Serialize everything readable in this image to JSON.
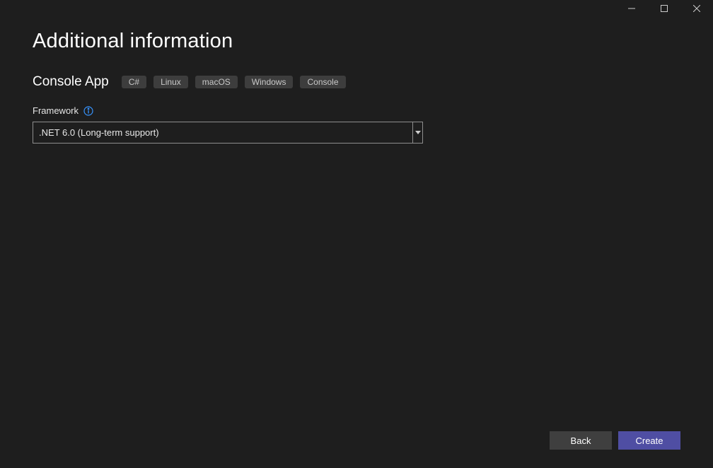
{
  "titlebar": {
    "icons": {
      "minimize": "minimize-icon",
      "maximize": "maximize-icon",
      "close": "close-icon"
    }
  },
  "page": {
    "title": "Additional information"
  },
  "template": {
    "name": "Console App",
    "tags": [
      "C#",
      "Linux",
      "macOS",
      "Windows",
      "Console"
    ]
  },
  "framework": {
    "label": "Framework",
    "selected": ".NET 6.0 (Long-term support)"
  },
  "footer": {
    "back": "Back",
    "create": "Create"
  }
}
